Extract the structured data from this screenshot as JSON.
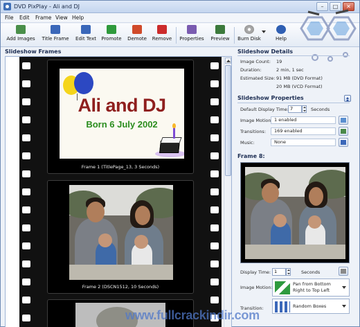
{
  "window": {
    "title": "DVD PixPlay - Ali and DJ"
  },
  "menu": [
    "File",
    "Edit",
    "Frame",
    "View",
    "Help"
  ],
  "toolbar": [
    {
      "label": "Add Images",
      "icon": "add-images-icon",
      "color": "#3a8a3a"
    },
    {
      "label": "Title Frame",
      "icon": "title-frame-icon",
      "color": "#2f5fb3"
    },
    {
      "label": "Edit Text",
      "icon": "edit-text-icon",
      "color": "#2f5fb3"
    },
    {
      "label": "Promote",
      "icon": "promote-icon",
      "color": "#2f9a3c"
    },
    {
      "label": "Demote",
      "icon": "demote-icon",
      "color": "#d04a2a"
    },
    {
      "label": "Remove",
      "icon": "remove-icon",
      "color": "#cc2b2b"
    },
    {
      "label": "Properties",
      "icon": "properties-icon",
      "color": "#7a5bb0"
    },
    {
      "label": "Preview",
      "icon": "preview-icon",
      "color": "#3c7a3c"
    },
    {
      "label": "Burn Disk",
      "icon": "burn-disk-icon",
      "color": "#6a6a6a"
    },
    {
      "label": "Help",
      "icon": "help-icon",
      "color": "#2f5fb3"
    }
  ],
  "main": {
    "header": "Slideshow Frames",
    "frames": [
      {
        "caption": "Frame 1  (TitlePage_13, 3 Seconds)",
        "title": "Ali and DJ",
        "subtitle": "Born 6 July 2002"
      },
      {
        "caption": "Frame 2  (DSCN1512, 10 Seconds)"
      }
    ]
  },
  "details": {
    "header": "Slideshow Details",
    "rows": [
      {
        "k": "Image Count:",
        "v": "19"
      },
      {
        "k": "Duration:",
        "v": "2 min, 1 sec"
      },
      {
        "k": "Estimated Size:",
        "v": "91 MB (DVD Format)"
      },
      {
        "k": "",
        "v": "20 MB (VCD Format)"
      }
    ]
  },
  "properties": {
    "header": "Slideshow Properties",
    "display_time_label": "Default Display Time:",
    "display_time_value": "7",
    "display_time_unit": "Seconds",
    "image_motion_label": "Image Motion:",
    "image_motion_value": "1 enabled",
    "transitions_label": "Transitions:",
    "transitions_value": "169 enabled",
    "music_label": "Music:",
    "music_value": "None"
  },
  "frame_panel": {
    "header": "Frame 8:",
    "display_time_label": "Display Time:",
    "display_time_value": "1",
    "display_time_unit": "Seconds",
    "image_motion_label": "Image Motion:",
    "image_motion_value": "Pan from Bottom Right to Top Left",
    "transition_label": "Transition:",
    "transition_value": "Random Boxes"
  },
  "watermark": "www.fullcrackindir.com"
}
